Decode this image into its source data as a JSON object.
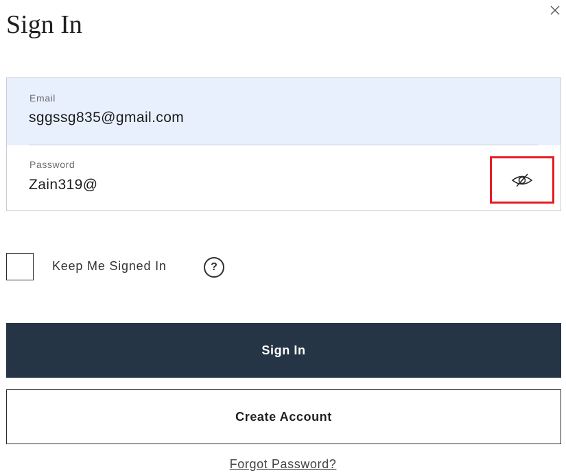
{
  "header": {
    "title": "Sign In",
    "close_icon": "close-icon"
  },
  "form": {
    "email": {
      "label": "Email",
      "value": "sggssg835@gmail.com",
      "background": "#e8f0fe"
    },
    "password": {
      "label": "Password",
      "value": "Zain319@",
      "toggle_icon": "eye-slash-icon",
      "highlight_color": "#e31b23"
    },
    "keep_signed_in": {
      "label": "Keep Me Signed In",
      "checked": false,
      "help_glyph": "?"
    }
  },
  "actions": {
    "sign_in_label": "Sign In",
    "sign_in_color": "#263545",
    "create_account_label": "Create Account",
    "forgot_password_label": "Forgot Password?"
  }
}
